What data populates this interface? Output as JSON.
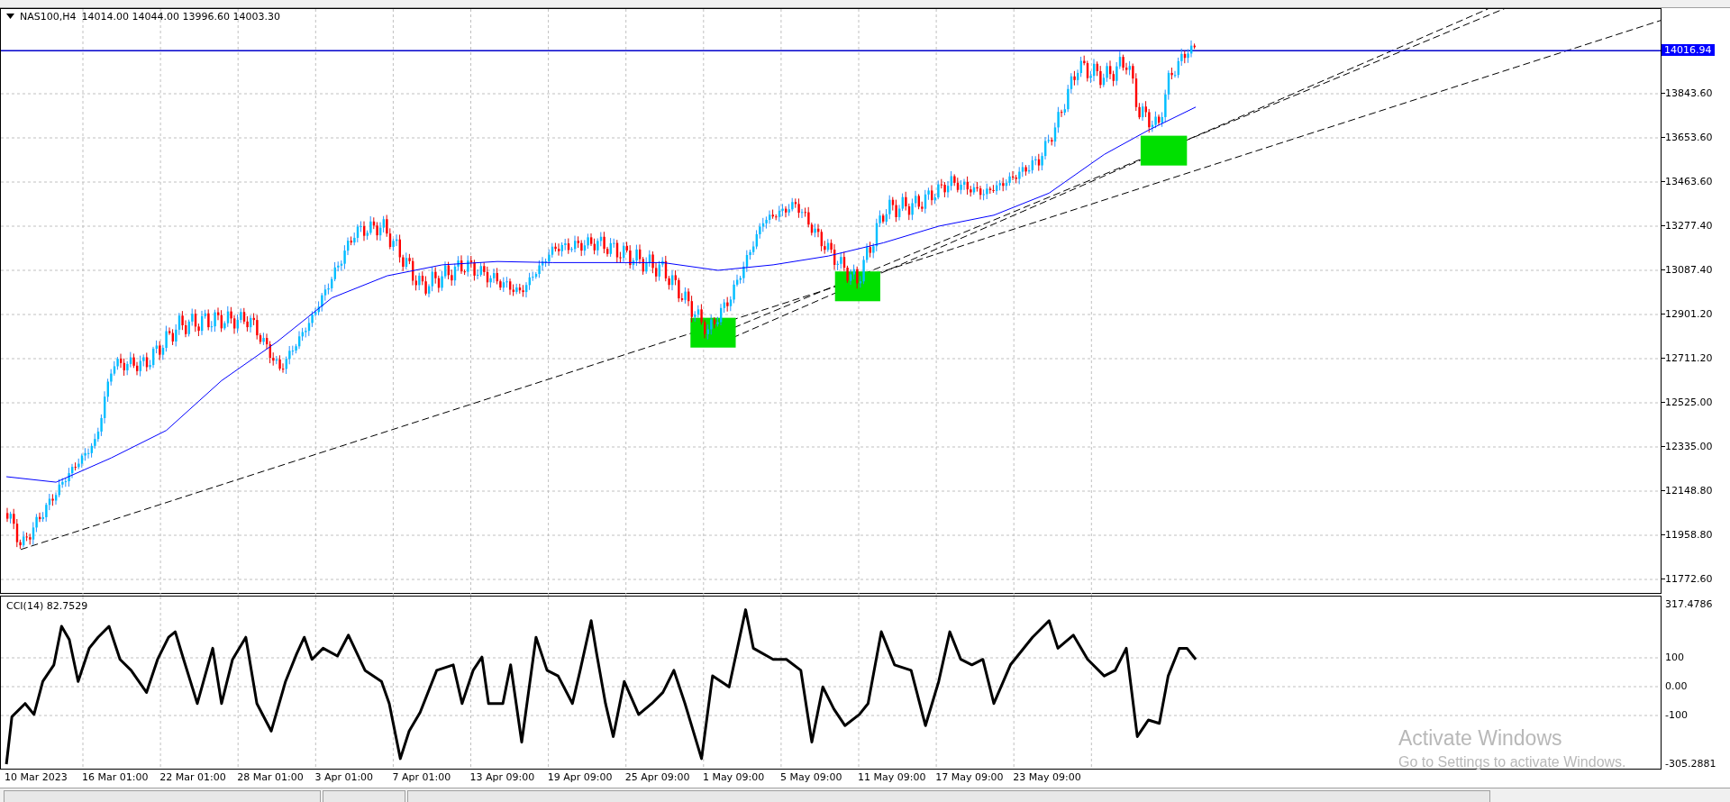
{
  "chart": {
    "symbol": "NAS100,H4",
    "quote": "14014.00 14044.00 13996.60 14003.30"
  },
  "price_axis": {
    "current_price": "14016.94",
    "labels": [
      "13843.60",
      "13653.60",
      "13463.60",
      "13277.40",
      "13087.40",
      "12901.20",
      "12711.20",
      "12525.00",
      "12335.00",
      "12148.80",
      "11958.80",
      "11772.60"
    ]
  },
  "indicator": {
    "label": "CCI(14) 82.7529",
    "axis_labels": [
      "317.4786",
      "100",
      "0.00",
      "-100",
      "-305.2881"
    ]
  },
  "time_axis": {
    "labels": [
      "10 Mar 2023",
      "16 Mar 01:00",
      "22 Mar 01:00",
      "28 Mar 01:00",
      "3 Apr 01:00",
      "7 Apr 01:00",
      "13 Apr 09:00",
      "19 Apr 09:00",
      "25 Apr 09:00",
      "1 May 09:00",
      "5 May 09:00",
      "11 May 09:00",
      "17 May 09:00",
      "23 May 09:00"
    ]
  },
  "os_notice": {
    "title": "Activate Windows",
    "message": "Go to Settings to activate Windows."
  }
}
